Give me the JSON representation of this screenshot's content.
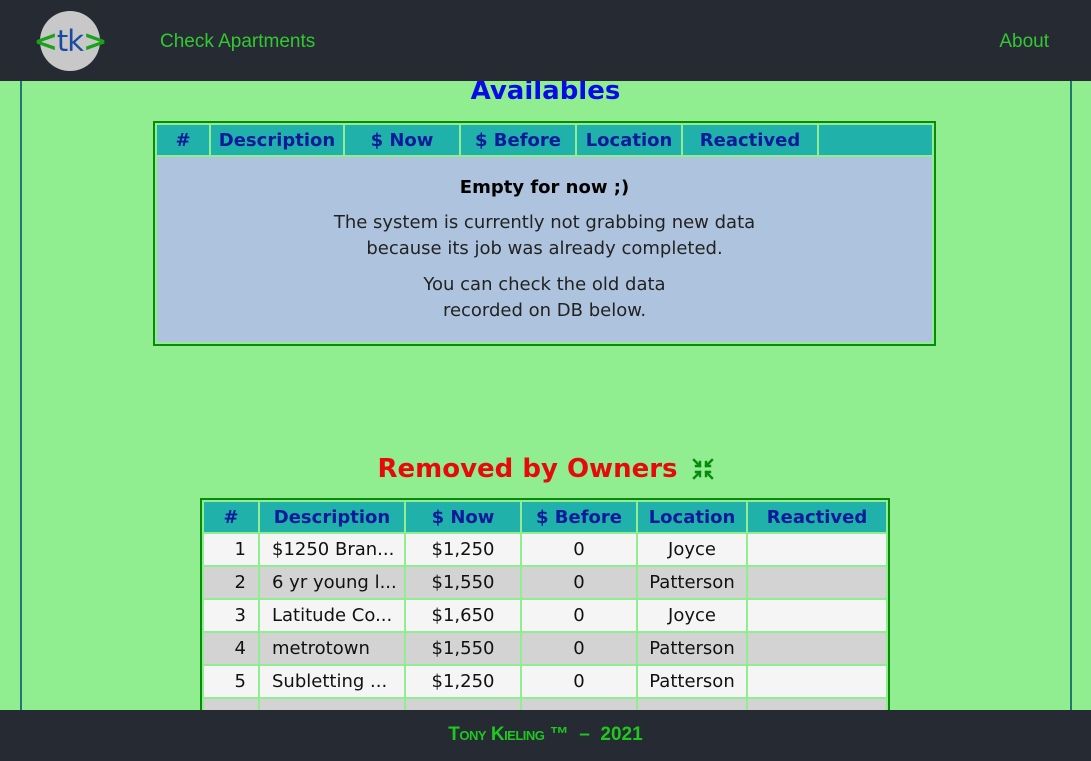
{
  "nav": {
    "logo": {
      "left_bracket": "<",
      "letters": "tk",
      "right_bracket": ">"
    },
    "check_apartments": "Check Apartments",
    "about": "About"
  },
  "availables": {
    "title": "Availables",
    "headers": [
      "#",
      "Description",
      "$ Now",
      "$ Before",
      "Location",
      "Reactived",
      ""
    ],
    "empty_title": "Empty for now ;)",
    "message_line1": "The system is currently not grabbing new data",
    "message_line2": "because its job was already completed.",
    "message_line3": "You can check the old data",
    "message_line4": "recorded on DB below."
  },
  "removed": {
    "title": "Removed by Owners",
    "icon": "compress-icon",
    "headers": [
      "#",
      "Description",
      "$ Now",
      "$ Before",
      "Location",
      "Reactived"
    ],
    "rows": [
      {
        "num": "1",
        "description": "$1250 Bran...",
        "now": "$1,250",
        "before": "0",
        "location": "Joyce",
        "reactived": ""
      },
      {
        "num": "2",
        "description": "6 yr young l...",
        "now": "$1,550",
        "before": "0",
        "location": "Patterson",
        "reactived": ""
      },
      {
        "num": "3",
        "description": "Latitude Co...",
        "now": "$1,650",
        "before": "0",
        "location": "Joyce",
        "reactived": ""
      },
      {
        "num": "4",
        "description": "metrotown",
        "now": "$1,550",
        "before": "0",
        "location": "Patterson",
        "reactived": ""
      },
      {
        "num": "5",
        "description": "Subletting ...",
        "now": "$1,250",
        "before": "0",
        "location": "Patterson",
        "reactived": ""
      }
    ]
  },
  "footer": {
    "name": "Tony Kieling",
    "tm": "™",
    "dash": "–",
    "year": "2021"
  },
  "colors": {
    "background": "#90ee90",
    "navbar": "#262a33",
    "header_cell": "#20b2aa",
    "availables_title": "#0a0ae6",
    "removed_title": "#e60a0a"
  }
}
